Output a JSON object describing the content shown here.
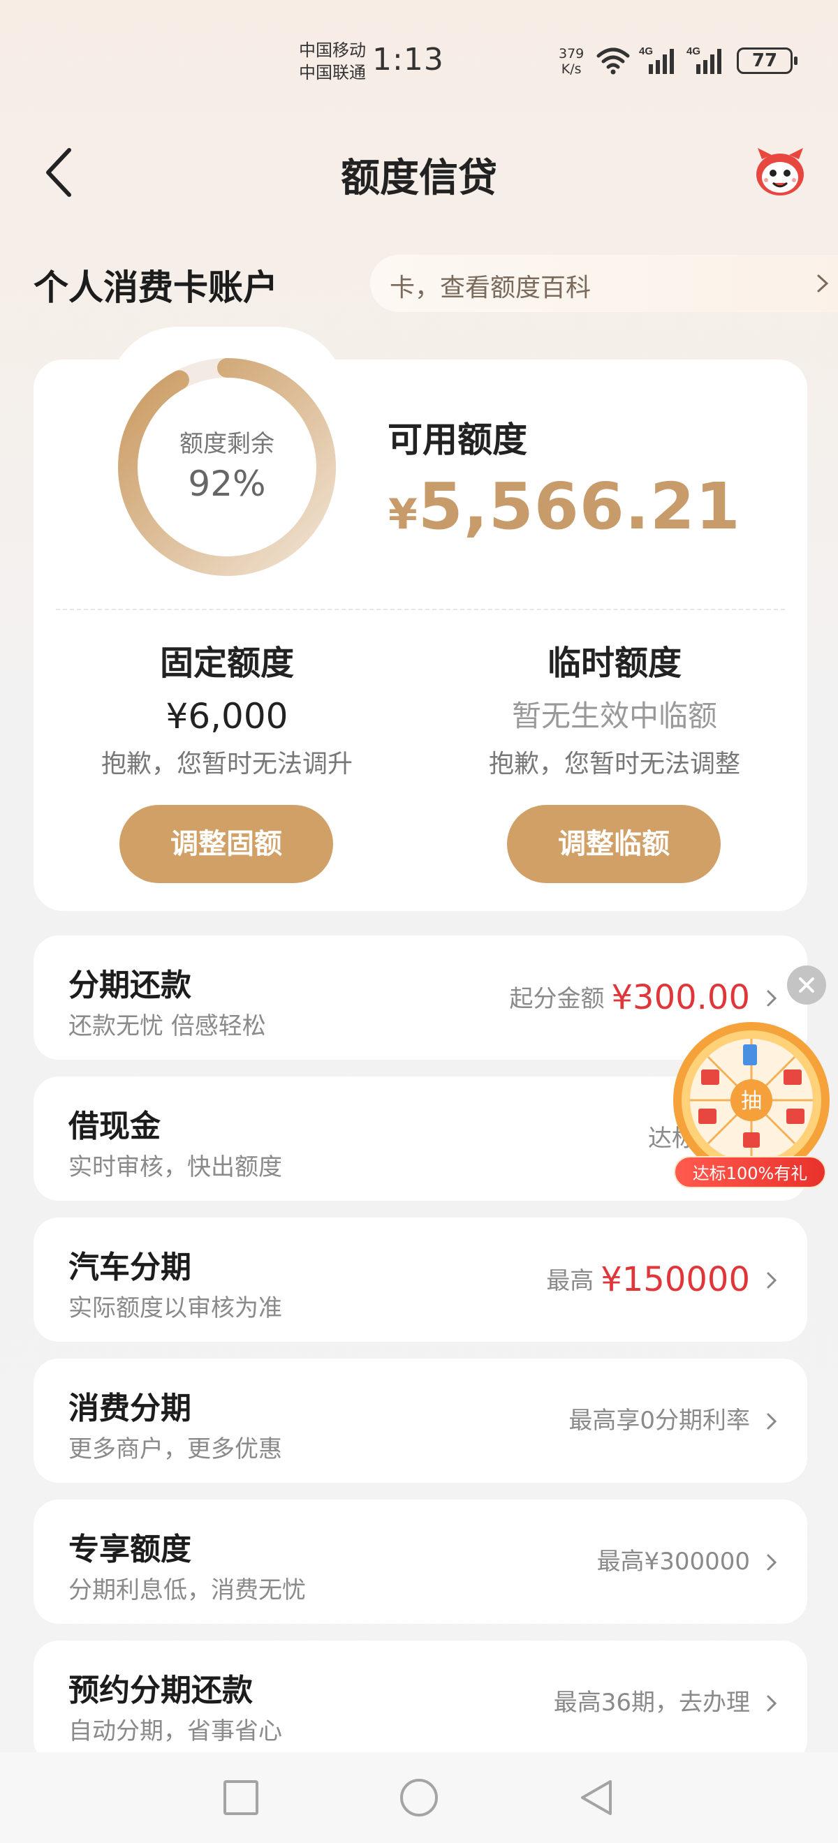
{
  "status_bar": {
    "carrier_1": "中国移动",
    "carrier_2": "中国联通",
    "time": "1:13",
    "net_speed_value": "379",
    "net_speed_unit": "K/s",
    "signal_1_label": "4G",
    "signal_2_label": "4G",
    "battery": "77"
  },
  "header": {
    "title": "额度信贷",
    "back_icon": "chevron-left-icon",
    "mascot_icon": "mascot-icon"
  },
  "account": {
    "title": "个人消费卡账户",
    "banner_text": "卡，查看额度百科"
  },
  "credit": {
    "ring_label": "额度剩余",
    "ring_percent_text": "92%",
    "ring_fraction": 0.92,
    "available_label": "可用额度",
    "currency": "¥",
    "available_amount": "5,566.21",
    "fixed": {
      "title": "固定额度",
      "amount": "¥6,000",
      "note": "抱歉，您暂时无法调升",
      "button": "调整固额"
    },
    "temporary": {
      "title": "临时额度",
      "amount": "暂无生效中临额",
      "note": "抱歉，您暂时无法调整",
      "button": "调整临额"
    }
  },
  "services": [
    {
      "title": "分期还款",
      "subtitle": "还款无忧 倍感轻松",
      "right_text": "起分金额",
      "right_highlight": "¥300.00"
    },
    {
      "title": "借现金",
      "subtitle": "实时审核，快出额度",
      "right_text": "达标",
      "right_highlight": ""
    },
    {
      "title": "汽车分期",
      "subtitle": "实际额度以审核为准",
      "right_text": "最高",
      "right_highlight": "¥150000"
    },
    {
      "title": "消费分期",
      "subtitle": "更多商户，更多优惠",
      "right_text": "最高享0分期利率",
      "right_highlight": ""
    },
    {
      "title": "专享额度",
      "subtitle": "分期利息低，消费无忧",
      "right_text": "最高¥300000",
      "right_highlight": ""
    },
    {
      "title": "预约分期还款",
      "subtitle": "自动分期，省事省心",
      "right_text": "最高36期，去办理",
      "right_highlight": ""
    }
  ],
  "lottery": {
    "center_label": "抽",
    "banner": "达标100%有礼"
  },
  "colors": {
    "accent_gold": "#d0a067",
    "amount_gold": "#c89b6a",
    "highlight_red": "#e0363a"
  }
}
